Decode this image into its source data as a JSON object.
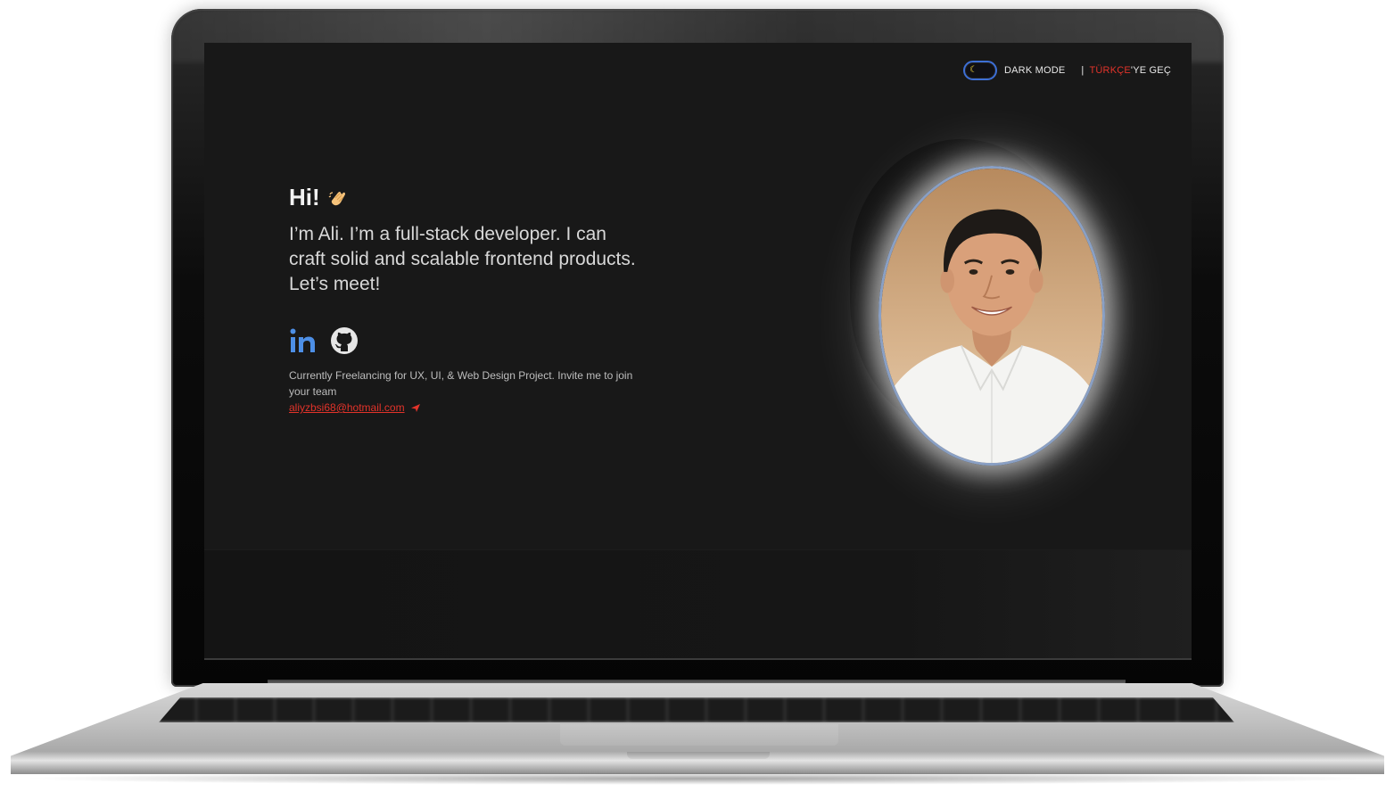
{
  "header": {
    "mode_label": "DARK MODE",
    "separator": "|",
    "lang_accent": "TÜRKÇE",
    "lang_rest": "'YE GEÇ"
  },
  "hero": {
    "greeting": "Hi!",
    "intro": "I’m Ali. I’m a full-stack developer. I can craft solid and scalable frontend products. Let’s meet!"
  },
  "status": {
    "text": "Currently Freelancing for UX, UI, & Web Design Project. Invite me to join your team",
    "email": "aliyzbsi68@hotmail.com"
  },
  "icons": {
    "toggle": "moon-icon",
    "greeting": "waving-hand-icon",
    "linkedin": "linkedin-icon",
    "github": "github-icon",
    "send": "paper-plane-icon"
  },
  "colors": {
    "background": "#181818",
    "accent_red": "#e2332a",
    "linkedin_blue": "#4d8fe6",
    "toggle_border": "#3d6fd6",
    "moon_yellow": "#f7d93b",
    "text_primary": "#f2f2f2"
  }
}
